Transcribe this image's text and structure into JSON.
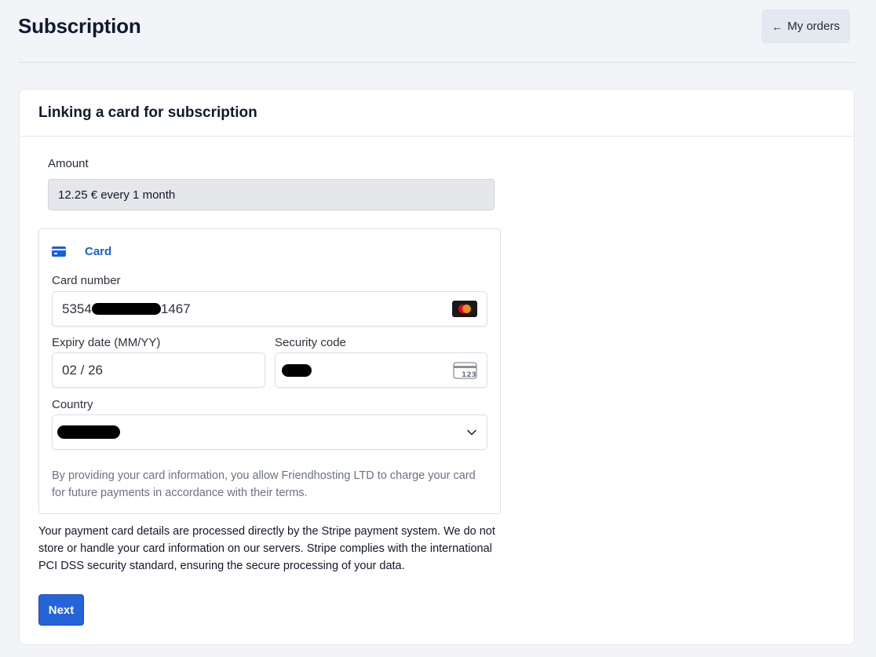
{
  "header": {
    "title": "Subscription",
    "orders_button": {
      "arrow": "←",
      "label": "My orders"
    }
  },
  "panel": {
    "title": "Linking a card for subscription",
    "amount": {
      "label": "Amount",
      "value": "12.25 € every 1 month"
    },
    "payment": {
      "tab_label": "Card",
      "card_number": {
        "label": "Card number",
        "prefix": "5354",
        "suffix": "1467",
        "brand_icon": "mastercard-icon"
      },
      "expiry": {
        "label": "Expiry date (MM/YY)",
        "value": "02 / 26"
      },
      "security_code": {
        "label": "Security code",
        "icon": "cvc-card-icon",
        "icon_text": "123"
      },
      "country": {
        "label": "Country"
      },
      "terms": "By providing your card information, you allow Friendhosting LTD to charge your card for future payments in accordance with their terms."
    },
    "info": "Your payment card details are processed directly by the Stripe payment system. We do not store or handle your card information on our servers. Stripe complies with the international PCI DSS security standard, ensuring the secure processing of your data.",
    "next_label": "Next"
  },
  "colors": {
    "accent": "#2563d9",
    "link": "#1a5fd6",
    "background": "#f3f4f8"
  }
}
